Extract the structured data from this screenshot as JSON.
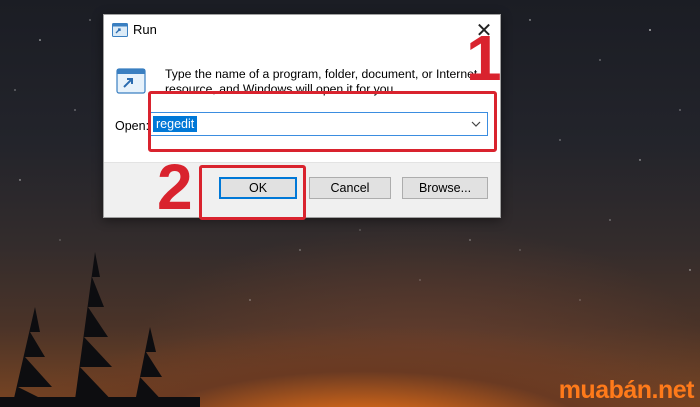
{
  "dialog": {
    "title": "Run",
    "close_glyph": "✕",
    "description": "Type the name of a program, folder, document, or Internet resource, and Windows will open it for you.",
    "open_label": "Open:",
    "open_value": "regedit",
    "buttons": {
      "ok": "OK",
      "cancel": "Cancel",
      "browse": "Browse..."
    }
  },
  "annotations": {
    "step1": "1",
    "step2": "2",
    "color": "#d9232e"
  },
  "watermark": "muabán.net",
  "icons": [
    "run-icon",
    "run-large-icon",
    "close-icon",
    "dropdown-arrow-icon"
  ]
}
